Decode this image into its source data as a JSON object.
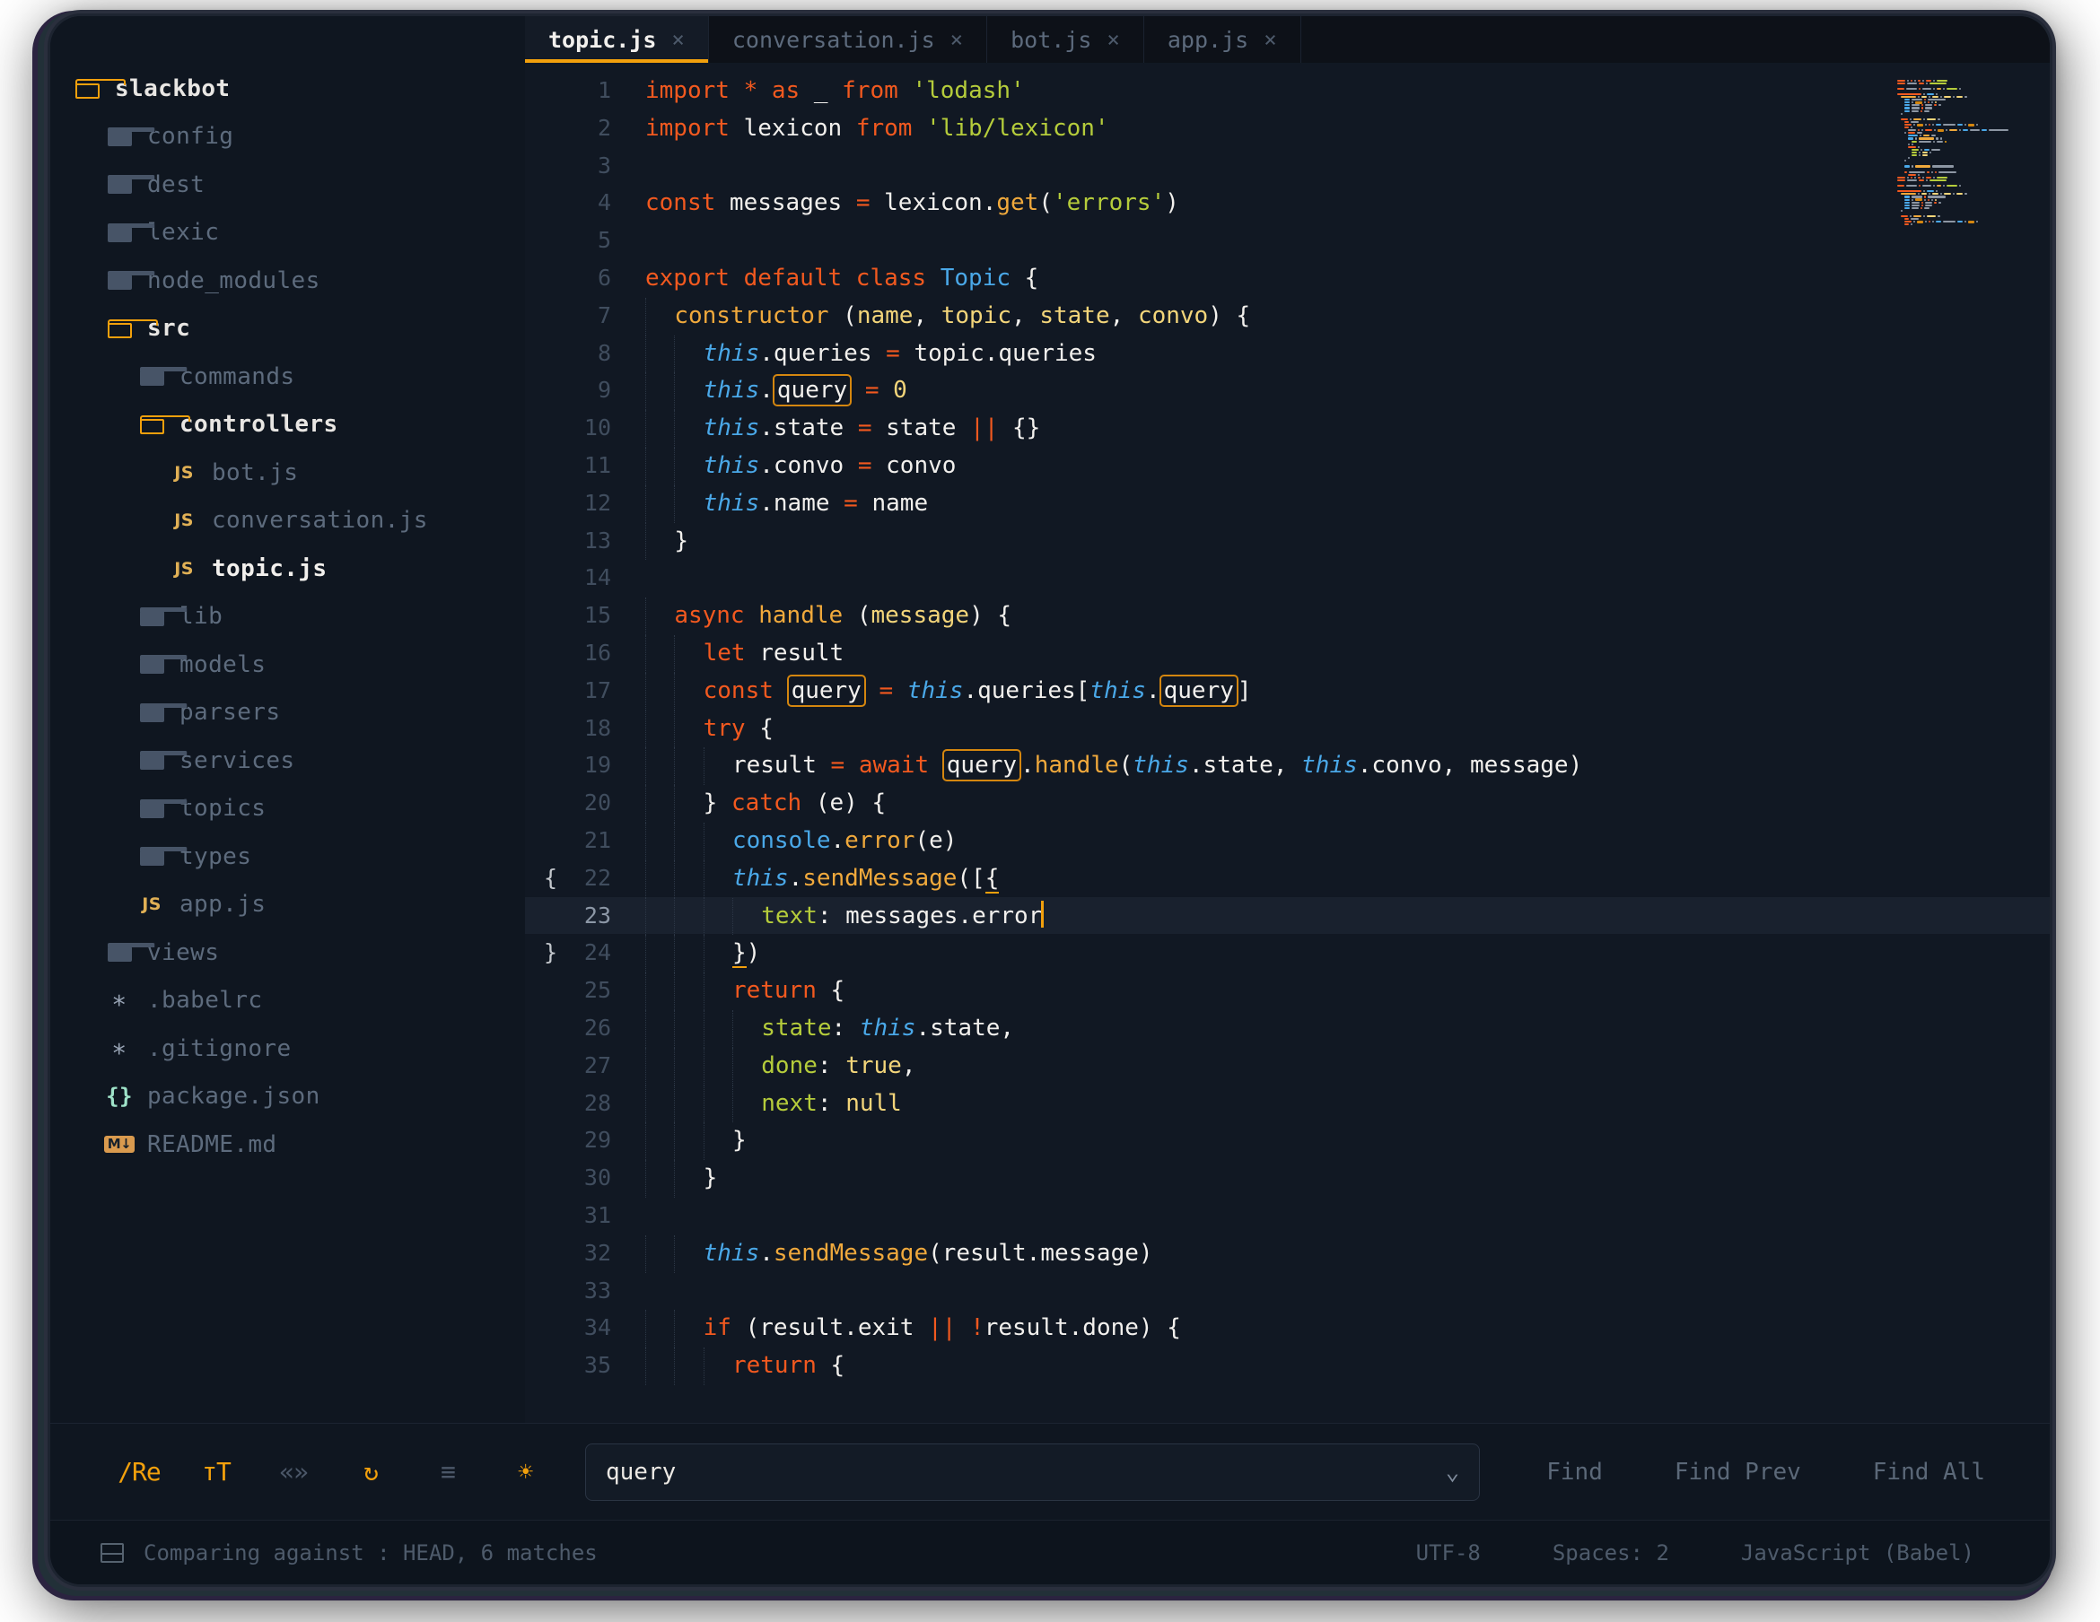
{
  "colors": {
    "accent": "#f2a00c",
    "keyword": "#f2591f",
    "string": "#b5cc3b",
    "class": "#4aa8e8",
    "function": "#f0a93c",
    "param": "#f3d57a",
    "editor_bg": "#111823",
    "sidebar_bg": "#0f1620",
    "match_border": "#d4860f"
  },
  "sidebar": {
    "items": [
      {
        "label": "slackbot",
        "icon": "folder-open-icon",
        "depth": 0,
        "state": "open"
      },
      {
        "label": "config",
        "icon": "folder-closed-icon",
        "depth": 1,
        "state": "closed"
      },
      {
        "label": "dest",
        "icon": "folder-closed-icon",
        "depth": 1,
        "state": "closed"
      },
      {
        "label": "lexic",
        "icon": "folder-closed-icon",
        "depth": 1,
        "state": "closed"
      },
      {
        "label": "node_modules",
        "icon": "folder-closed-icon",
        "depth": 1,
        "state": "closed"
      },
      {
        "label": "src",
        "icon": "folder-open-icon",
        "depth": 1,
        "state": "open"
      },
      {
        "label": "commands",
        "icon": "folder-closed-icon",
        "depth": 2,
        "state": "closed"
      },
      {
        "label": "controllers",
        "icon": "folder-open-icon",
        "depth": 2,
        "state": "open"
      },
      {
        "label": "bot.js",
        "icon": "js-file-icon",
        "depth": 3,
        "state": "file"
      },
      {
        "label": "conversation.js",
        "icon": "js-file-icon",
        "depth": 3,
        "state": "file"
      },
      {
        "label": "topic.js",
        "icon": "js-file-icon",
        "depth": 3,
        "state": "file-active"
      },
      {
        "label": "lib",
        "icon": "folder-closed-icon",
        "depth": 2,
        "state": "closed"
      },
      {
        "label": "models",
        "icon": "folder-closed-icon",
        "depth": 2,
        "state": "closed"
      },
      {
        "label": "parsers",
        "icon": "folder-closed-icon",
        "depth": 2,
        "state": "closed"
      },
      {
        "label": "services",
        "icon": "folder-closed-icon",
        "depth": 2,
        "state": "closed"
      },
      {
        "label": "topics",
        "icon": "folder-closed-icon",
        "depth": 2,
        "state": "closed"
      },
      {
        "label": "types",
        "icon": "folder-closed-icon",
        "depth": 2,
        "state": "closed"
      },
      {
        "label": "app.js",
        "icon": "js-file-icon",
        "depth": 2,
        "state": "file"
      },
      {
        "label": "views",
        "icon": "folder-closed-icon",
        "depth": 1,
        "state": "closed"
      },
      {
        "label": ".babelrc",
        "icon": "star-file-icon",
        "depth": 1,
        "state": "file"
      },
      {
        "label": ".gitignore",
        "icon": "star-file-icon",
        "depth": 1,
        "state": "file"
      },
      {
        "label": "package.json",
        "icon": "json-file-icon",
        "depth": 1,
        "state": "file"
      },
      {
        "label": "README.md",
        "icon": "markdown-file-icon",
        "depth": 1,
        "state": "file",
        "icon_text": "M↓"
      }
    ]
  },
  "tabs": [
    {
      "label": "topic.js",
      "close": "×",
      "active": true
    },
    {
      "label": "conversation.js",
      "close": "×",
      "active": false
    },
    {
      "label": "bot.js",
      "close": "×",
      "active": false
    },
    {
      "label": "app.js",
      "close": "×",
      "active": false
    }
  ],
  "editor": {
    "current_line": 23,
    "first_line": 1,
    "last_line": 35,
    "fold_open_line": 22,
    "fold_close_line": 24,
    "lines": [
      {
        "n": 1,
        "indent": 0,
        "t": [
          [
            "kw",
            "import"
          ],
          [
            "pln",
            " "
          ],
          [
            "op",
            "*"
          ],
          [
            "pln",
            " "
          ],
          [
            "kw",
            "as"
          ],
          [
            "pln",
            " _ "
          ],
          [
            "kw",
            "from"
          ],
          [
            "pln",
            " "
          ],
          [
            "str",
            "'lodash'"
          ]
        ]
      },
      {
        "n": 2,
        "indent": 0,
        "t": [
          [
            "kw",
            "import"
          ],
          [
            "pln",
            " lexicon "
          ],
          [
            "kw",
            "from"
          ],
          [
            "pln",
            " "
          ],
          [
            "str",
            "'lib/lexicon'"
          ]
        ]
      },
      {
        "n": 3,
        "indent": 0,
        "t": []
      },
      {
        "n": 4,
        "indent": 0,
        "t": [
          [
            "kw",
            "const"
          ],
          [
            "pln",
            " messages "
          ],
          [
            "op",
            "="
          ],
          [
            "pln",
            " lexicon"
          ],
          [
            "pln",
            "."
          ],
          [
            "fn",
            "get"
          ],
          [
            "pln",
            "("
          ],
          [
            "str",
            "'errors'"
          ],
          [
            "pln",
            ")"
          ]
        ]
      },
      {
        "n": 5,
        "indent": 0,
        "t": []
      },
      {
        "n": 6,
        "indent": 0,
        "t": [
          [
            "kw",
            "export default class"
          ],
          [
            "pln",
            " "
          ],
          [
            "cls",
            "Topic"
          ],
          [
            "pln",
            " {"
          ]
        ]
      },
      {
        "n": 7,
        "indent": 1,
        "t": [
          [
            "fn",
            "constructor"
          ],
          [
            "pln",
            " ("
          ],
          [
            "par",
            "name"
          ],
          [
            "pln",
            ", "
          ],
          [
            "par",
            "topic"
          ],
          [
            "pln",
            ", "
          ],
          [
            "par",
            "state"
          ],
          [
            "pln",
            ", "
          ],
          [
            "par",
            "convo"
          ],
          [
            "pln",
            ") {"
          ]
        ]
      },
      {
        "n": 8,
        "indent": 2,
        "t": [
          [
            "ths",
            "this"
          ],
          [
            "pln",
            ".queries "
          ],
          [
            "op",
            "="
          ],
          [
            "pln",
            " topic.queries"
          ]
        ]
      },
      {
        "n": 9,
        "indent": 2,
        "t": [
          [
            "ths",
            "this"
          ],
          [
            "pln",
            "."
          ],
          [
            "match",
            "query"
          ],
          [
            "pln",
            " "
          ],
          [
            "op",
            "="
          ],
          [
            "pln",
            " "
          ],
          [
            "num",
            "0"
          ]
        ]
      },
      {
        "n": 10,
        "indent": 2,
        "t": [
          [
            "ths",
            "this"
          ],
          [
            "pln",
            ".state "
          ],
          [
            "op",
            "="
          ],
          [
            "pln",
            " state "
          ],
          [
            "op",
            "||"
          ],
          [
            "pln",
            " {}"
          ]
        ]
      },
      {
        "n": 11,
        "indent": 2,
        "t": [
          [
            "ths",
            "this"
          ],
          [
            "pln",
            ".convo "
          ],
          [
            "op",
            "="
          ],
          [
            "pln",
            " convo"
          ]
        ]
      },
      {
        "n": 12,
        "indent": 2,
        "t": [
          [
            "ths",
            "this"
          ],
          [
            "pln",
            ".name "
          ],
          [
            "op",
            "="
          ],
          [
            "pln",
            " name"
          ]
        ]
      },
      {
        "n": 13,
        "indent": 1,
        "t": [
          [
            "pln",
            "}"
          ]
        ]
      },
      {
        "n": 14,
        "indent": 0,
        "t": []
      },
      {
        "n": 15,
        "indent": 1,
        "t": [
          [
            "kw",
            "async"
          ],
          [
            "pln",
            " "
          ],
          [
            "fn",
            "handle"
          ],
          [
            "pln",
            " ("
          ],
          [
            "par",
            "message"
          ],
          [
            "pln",
            ") {"
          ]
        ]
      },
      {
        "n": 16,
        "indent": 2,
        "t": [
          [
            "kw",
            "let"
          ],
          [
            "pln",
            " result"
          ]
        ]
      },
      {
        "n": 17,
        "indent": 2,
        "t": [
          [
            "kw",
            "const"
          ],
          [
            "pln",
            " "
          ],
          [
            "match",
            "query"
          ],
          [
            "pln",
            " "
          ],
          [
            "op",
            "="
          ],
          [
            "pln",
            " "
          ],
          [
            "ths",
            "this"
          ],
          [
            "pln",
            ".queries["
          ],
          [
            "ths",
            "this"
          ],
          [
            "pln",
            "."
          ],
          [
            "match",
            "query"
          ],
          [
            "pln",
            "]"
          ]
        ]
      },
      {
        "n": 18,
        "indent": 2,
        "t": [
          [
            "kw",
            "try"
          ],
          [
            "pln",
            " {"
          ]
        ]
      },
      {
        "n": 19,
        "indent": 3,
        "t": [
          [
            "pln",
            "result "
          ],
          [
            "op",
            "="
          ],
          [
            "pln",
            " "
          ],
          [
            "kw",
            "await"
          ],
          [
            "pln",
            " "
          ],
          [
            "match",
            "query"
          ],
          [
            "pln",
            "."
          ],
          [
            "fn",
            "handle"
          ],
          [
            "pln",
            "("
          ],
          [
            "ths",
            "this"
          ],
          [
            "pln",
            ".state, "
          ],
          [
            "ths",
            "this"
          ],
          [
            "pln",
            ".convo, message)"
          ]
        ]
      },
      {
        "n": 20,
        "indent": 2,
        "t": [
          [
            "pln",
            "} "
          ],
          [
            "kw",
            "catch"
          ],
          [
            "pln",
            " (e) {"
          ]
        ]
      },
      {
        "n": 21,
        "indent": 3,
        "t": [
          [
            "cls",
            "console"
          ],
          [
            "pln",
            "."
          ],
          [
            "fn",
            "error"
          ],
          [
            "pln",
            "(e)"
          ]
        ]
      },
      {
        "n": 22,
        "indent": 3,
        "t": [
          [
            "ths",
            "this"
          ],
          [
            "pln",
            "."
          ],
          [
            "fn",
            "sendMessage"
          ],
          [
            "pln",
            "(["
          ],
          [
            "mb",
            "{"
          ]
        ]
      },
      {
        "n": 23,
        "indent": 4,
        "t": [
          [
            "prop",
            "text"
          ],
          [
            "pln",
            ": messages"
          ],
          [
            "pln",
            "."
          ],
          [
            "pln",
            "error"
          ],
          [
            "caret",
            ""
          ]
        ]
      },
      {
        "n": 24,
        "indent": 3,
        "t": [
          [
            "mb",
            "}"
          ],
          [
            "pln",
            ")"
          ]
        ]
      },
      {
        "n": 25,
        "indent": 3,
        "t": [
          [
            "kw",
            "return"
          ],
          [
            "pln",
            " {"
          ]
        ]
      },
      {
        "n": 26,
        "indent": 4,
        "t": [
          [
            "prop",
            "state"
          ],
          [
            "pln",
            ": "
          ],
          [
            "ths",
            "this"
          ],
          [
            "pln",
            ".state,"
          ]
        ]
      },
      {
        "n": 27,
        "indent": 4,
        "t": [
          [
            "prop",
            "done"
          ],
          [
            "pln",
            ": "
          ],
          [
            "num",
            "true"
          ],
          [
            "pln",
            ","
          ]
        ]
      },
      {
        "n": 28,
        "indent": 4,
        "t": [
          [
            "prop",
            "next"
          ],
          [
            "pln",
            ": "
          ],
          [
            "num",
            "null"
          ]
        ]
      },
      {
        "n": 29,
        "indent": 3,
        "t": [
          [
            "pln",
            "}"
          ]
        ]
      },
      {
        "n": 30,
        "indent": 2,
        "t": [
          [
            "pln",
            "}"
          ]
        ]
      },
      {
        "n": 31,
        "indent": 0,
        "t": []
      },
      {
        "n": 32,
        "indent": 2,
        "t": [
          [
            "ths",
            "this"
          ],
          [
            "pln",
            "."
          ],
          [
            "fn",
            "sendMessage"
          ],
          [
            "pln",
            "(result.message)"
          ]
        ]
      },
      {
        "n": 33,
        "indent": 0,
        "t": []
      },
      {
        "n": 34,
        "indent": 2,
        "t": [
          [
            "kw",
            "if"
          ],
          [
            "pln",
            " (result.exit "
          ],
          [
            "op",
            "||"
          ],
          [
            "pln",
            " "
          ],
          [
            "op",
            "!"
          ],
          [
            "pln",
            "result.done) {"
          ]
        ]
      },
      {
        "n": 35,
        "indent": 3,
        "t": [
          [
            "kw",
            "return"
          ],
          [
            "pln",
            " {"
          ]
        ]
      }
    ]
  },
  "findbar": {
    "tools": [
      {
        "name": "regex-toggle",
        "glyph": "/Re",
        "active": true
      },
      {
        "name": "case-sensitive-toggle",
        "glyph": "тT",
        "active": true
      },
      {
        "name": "whole-word-toggle",
        "glyph": "«»",
        "active": false
      },
      {
        "name": "wrap-search-toggle",
        "glyph": "↻",
        "active": true
      },
      {
        "name": "in-selection-toggle",
        "glyph": "≡",
        "active": false
      },
      {
        "name": "highlight-results-toggle",
        "glyph": "☀",
        "active": true
      }
    ],
    "search_value": "query",
    "search_placeholder": "Find",
    "history_chevron": "⌄",
    "buttons": [
      {
        "label": "Find"
      },
      {
        "label": "Find Prev"
      },
      {
        "label": "Find All"
      }
    ]
  },
  "statusbar": {
    "git_text": "Comparing against : HEAD, 6 matches",
    "right_items": [
      {
        "label": "UTF-8"
      },
      {
        "label": "Spaces: 2"
      },
      {
        "label": "JavaScript (Babel)"
      }
    ]
  }
}
